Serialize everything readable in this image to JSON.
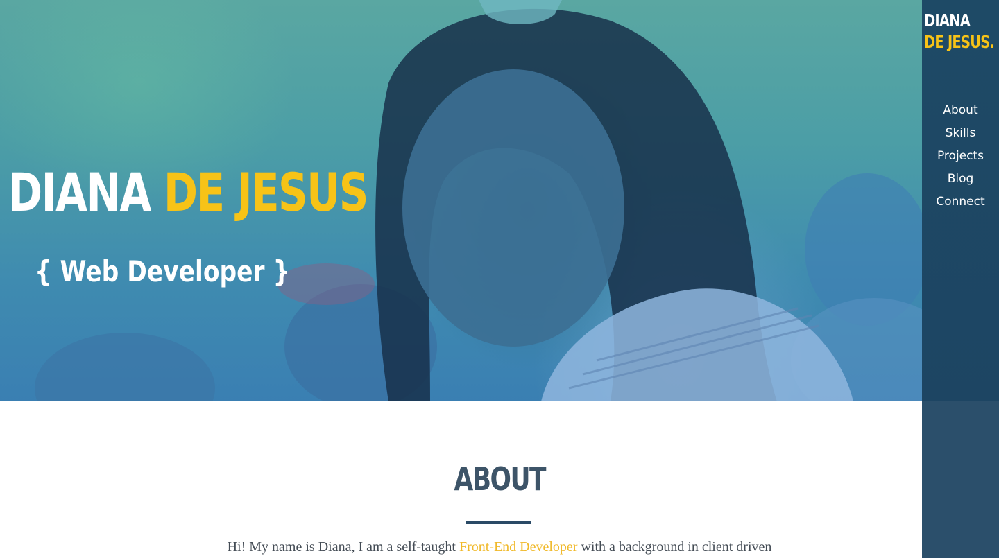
{
  "colors": {
    "accent": "#f7c317",
    "sidebar": "#1d4563",
    "heading": "#3d5468"
  },
  "hero": {
    "photo": "portrait-photo",
    "first_name": "DIANA",
    "last_name": "DE JESUS",
    "subtitle": "{ Web Developer }"
  },
  "logo": {
    "line1": "DIANA",
    "line2": "DE JESUS."
  },
  "nav": {
    "items": [
      {
        "label": "About"
      },
      {
        "label": "Skills"
      },
      {
        "label": "Projects"
      },
      {
        "label": "Blog"
      },
      {
        "label": "Connect"
      }
    ]
  },
  "about": {
    "heading": "ABOUT",
    "text_before": "Hi! My name is Diana, I am a self-taught",
    "highlight": "Front-End Developer",
    "text_after": "with a background in client driven"
  }
}
